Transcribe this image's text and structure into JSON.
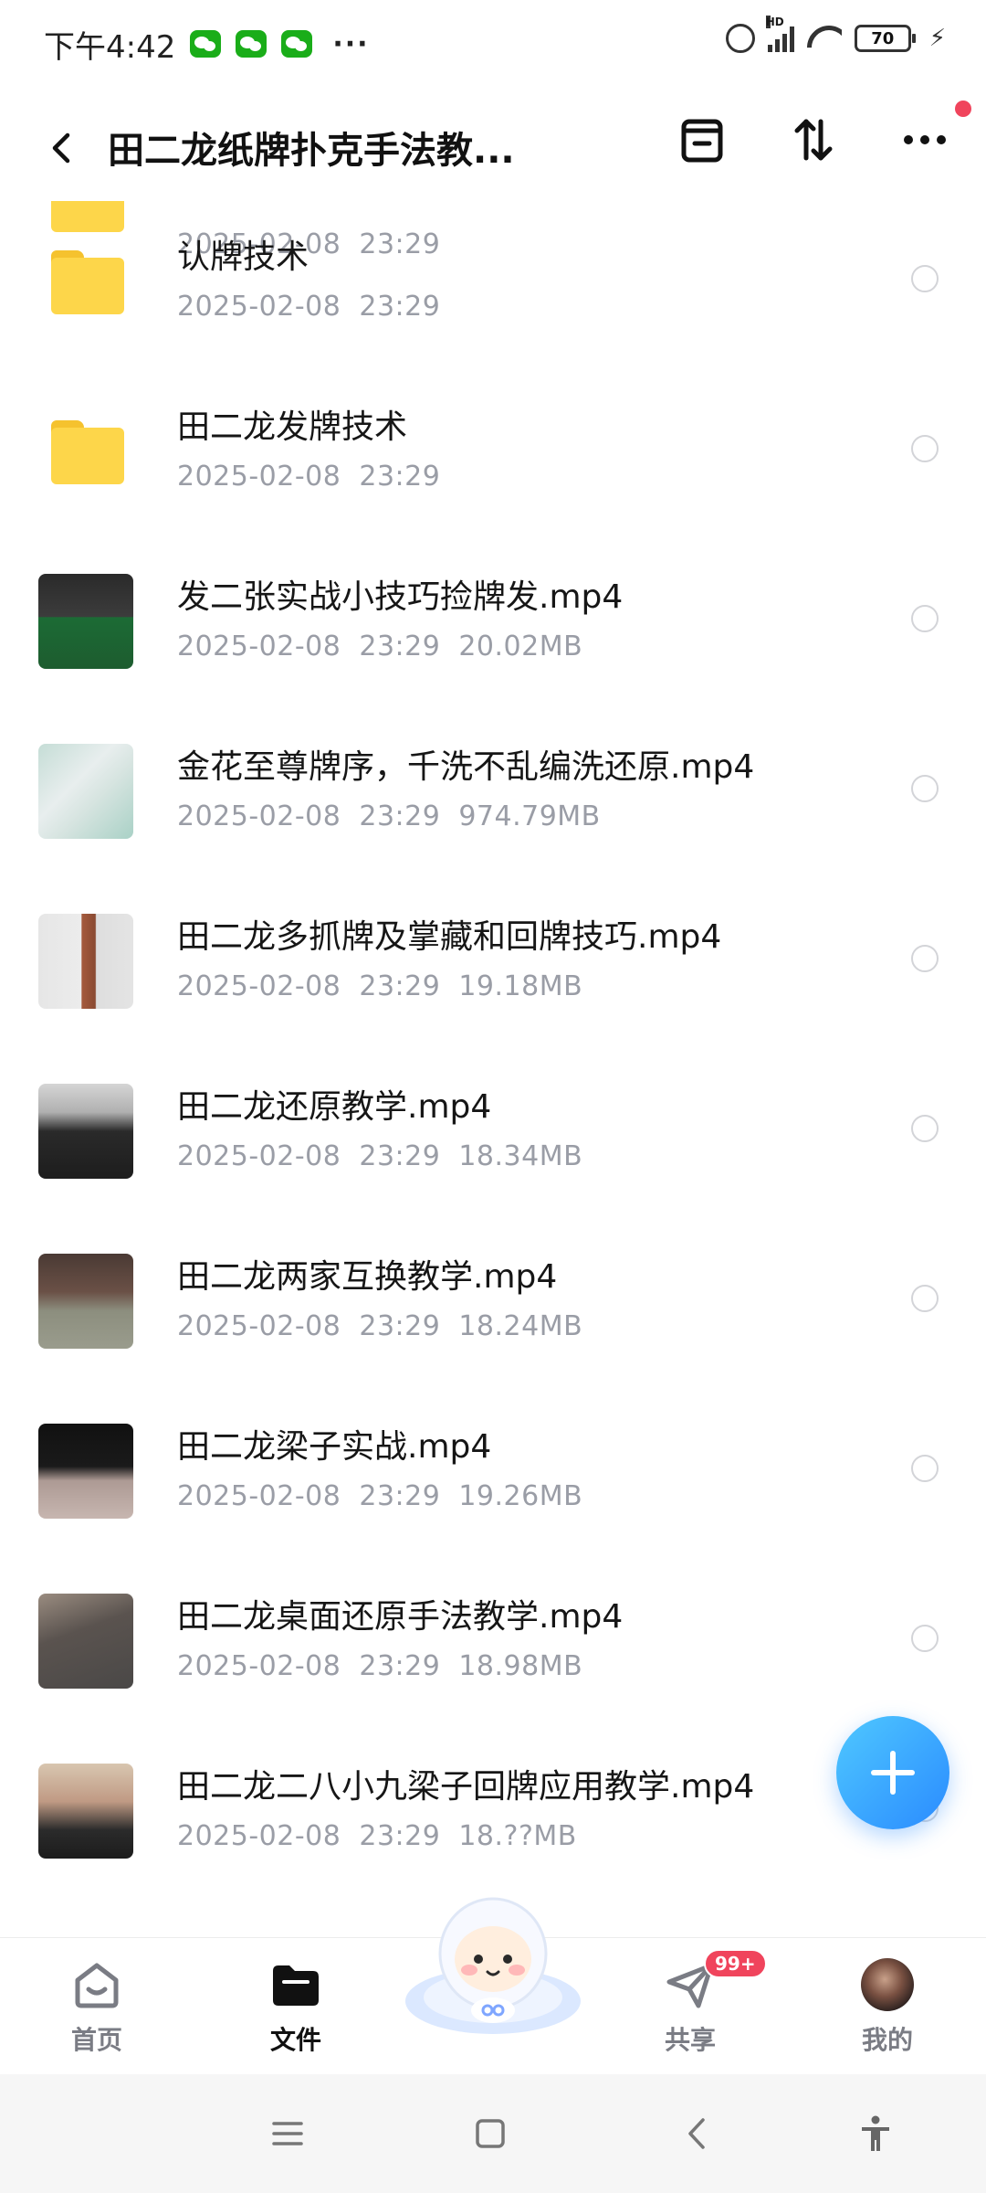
{
  "status_bar": {
    "time": "下午4:42",
    "more": "···",
    "battery_level": "70",
    "battery_fraction": 0.7,
    "network_label": "HD",
    "charging_icon": "⚡"
  },
  "header": {
    "title": "田二龙纸牌扑克手法教...",
    "icons": [
      "back-icon",
      "archive-icon",
      "sort-icon",
      "more-icon"
    ]
  },
  "files": [
    {
      "name": "",
      "date": "2025-02-08",
      "time": "23:29",
      "size": "",
      "type": "folder"
    },
    {
      "name": "认牌技术",
      "date": "2025-02-08",
      "time": "23:29",
      "size": "",
      "type": "folder"
    },
    {
      "name": "田二龙发牌技术",
      "date": "2025-02-08",
      "time": "23:29",
      "size": "",
      "type": "folder"
    },
    {
      "name": "发二张实战小技巧捡牌发.mp4",
      "date": "2025-02-08",
      "time": "23:29",
      "size": "20.02MB",
      "type": "video"
    },
    {
      "name": "金花至尊牌序，千洗不乱编洗还原.mp4",
      "date": "2025-02-08",
      "time": "23:29",
      "size": "974.79MB",
      "type": "video"
    },
    {
      "name": "田二龙多抓牌及掌藏和回牌技巧.mp4",
      "date": "2025-02-08",
      "time": "23:29",
      "size": "19.18MB",
      "type": "video"
    },
    {
      "name": "田二龙还原教学.mp4",
      "date": "2025-02-08",
      "time": "23:29",
      "size": "18.34MB",
      "type": "video"
    },
    {
      "name": "田二龙两家互换教学.mp4",
      "date": "2025-02-08",
      "time": "23:29",
      "size": "18.24MB",
      "type": "video"
    },
    {
      "name": "田二龙梁子实战.mp4",
      "date": "2025-02-08",
      "time": "23:29",
      "size": "19.26MB",
      "type": "video"
    },
    {
      "name": "田二龙桌面还原手法教学.mp4",
      "date": "2025-02-08",
      "time": "23:29",
      "size": "18.98MB",
      "type": "video"
    },
    {
      "name": "田二龙二八小九梁子回牌应用教学.mp4",
      "date": "2025-02-08",
      "time": "23:29",
      "size": "18.??MB",
      "type": "video"
    }
  ],
  "bottom_nav": [
    {
      "label": "首页",
      "icon": "home-icon"
    },
    {
      "label": "文件",
      "icon": "folder-icon",
      "active": true
    },
    {
      "label": "共享",
      "icon": "send-icon",
      "badge": "99+"
    },
    {
      "label": "我的",
      "icon": "avatar"
    }
  ],
  "colors": {
    "accent": "#2a8bff",
    "badge": "#f0445c",
    "folder": "#fdd64a",
    "meta_text": "#9a9da6"
  }
}
